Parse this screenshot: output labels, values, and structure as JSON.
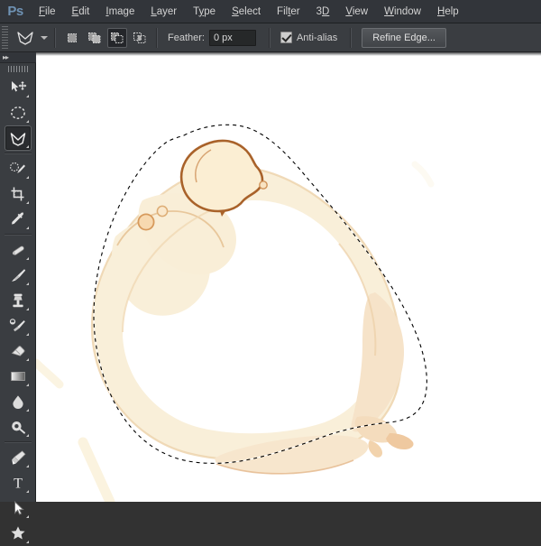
{
  "app": {
    "name": "Adobe Photoshop",
    "logo_text": "Ps",
    "theme_bg": "#3a3d41",
    "menubar_bg": "#32353a",
    "accent": "#6f92b4"
  },
  "menubar": {
    "items": [
      {
        "label": "File",
        "accel": "F"
      },
      {
        "label": "Edit",
        "accel": "E"
      },
      {
        "label": "Image",
        "accel": "I"
      },
      {
        "label": "Layer",
        "accel": "L"
      },
      {
        "label": "Type",
        "accel": "T"
      },
      {
        "label": "Select",
        "accel": "S"
      },
      {
        "label": "Filter",
        "accel": "t"
      },
      {
        "label": "3D",
        "accel": "D"
      },
      {
        "label": "View",
        "accel": "V"
      },
      {
        "label": "Window",
        "accel": "W"
      },
      {
        "label": "Help",
        "accel": "H"
      }
    ]
  },
  "options_bar": {
    "active_tool_icon": "polygonal-lasso-icon",
    "tool_preset_picker": "tool-preset-picker",
    "selection_modes": [
      {
        "name": "new-selection",
        "label": "New selection",
        "active": false
      },
      {
        "name": "add-to-selection",
        "label": "Add to selection",
        "active": false
      },
      {
        "name": "subtract-from-selection",
        "label": "Subtract from selection",
        "active": true
      },
      {
        "name": "intersect-selection",
        "label": "Intersect with selection",
        "active": false
      }
    ],
    "feather": {
      "label": "Feather:",
      "value": "0 px",
      "placeholder": "0 px"
    },
    "anti_alias": {
      "label": "Anti-alias",
      "checked": true
    },
    "refine_edge": {
      "label": "Refine Edge..."
    }
  },
  "toolbar": {
    "collapse_icon": "double-chevron-icon",
    "grip": "panel-drag-grip",
    "tools": [
      {
        "name": "move-tool",
        "label": "Move Tool",
        "active": false,
        "has_flyout": true
      },
      {
        "name": "elliptical-marquee-tool",
        "label": "Elliptical Marquee Tool",
        "active": false,
        "has_flyout": true
      },
      {
        "name": "polygonal-lasso-tool",
        "label": "Polygonal Lasso Tool",
        "active": true,
        "has_flyout": true
      },
      {
        "name": "quick-selection-tool",
        "label": "Quick Selection Tool",
        "active": false,
        "has_flyout": true
      },
      {
        "name": "crop-tool",
        "label": "Crop Tool",
        "active": false,
        "has_flyout": true
      },
      {
        "name": "eyedropper-tool",
        "label": "Eyedropper Tool",
        "active": false,
        "has_flyout": true
      },
      {
        "name": "spot-healing-brush-tool",
        "label": "Spot Healing Brush Tool",
        "active": false,
        "has_flyout": true
      },
      {
        "name": "brush-tool",
        "label": "Brush Tool",
        "active": false,
        "has_flyout": true
      },
      {
        "name": "clone-stamp-tool",
        "label": "Clone Stamp Tool",
        "active": false,
        "has_flyout": true
      },
      {
        "name": "history-brush-tool",
        "label": "History Brush Tool",
        "active": false,
        "has_flyout": true
      },
      {
        "name": "eraser-tool",
        "label": "Eraser Tool",
        "active": false,
        "has_flyout": true
      },
      {
        "name": "gradient-tool",
        "label": "Gradient Tool",
        "active": false,
        "has_flyout": true
      },
      {
        "name": "blur-tool",
        "label": "Blur Tool",
        "active": false,
        "has_flyout": true
      },
      {
        "name": "dodge-tool",
        "label": "Dodge Tool",
        "active": false,
        "has_flyout": true
      },
      {
        "name": "pen-tool",
        "label": "Pen Tool",
        "active": false,
        "has_flyout": true
      },
      {
        "name": "horizontal-type-tool",
        "label": "Horizontal Type Tool",
        "active": false,
        "has_flyout": true
      },
      {
        "name": "path-selection-tool",
        "label": "Path Selection Tool",
        "active": false,
        "has_flyout": true
      },
      {
        "name": "custom-shape-tool",
        "label": "Custom Shape Tool",
        "active": false,
        "has_flyout": true
      }
    ]
  },
  "document": {
    "background": "#ffffff",
    "subject": "coffee-cup-ring-stain",
    "selection": {
      "type": "polygonal-lasso-selection",
      "style": "marching-ants",
      "active": true
    },
    "stain_colors": {
      "ring_fill": "#faf0dc",
      "ring_edge": "#e8c79a",
      "blob_fill": "#fbeed3",
      "blob_edge": "#a9622a",
      "droplet_fill": "#f7d9b0",
      "droplet_edge": "#d79a5c",
      "faint_stroke": "#fbf6e4"
    }
  }
}
